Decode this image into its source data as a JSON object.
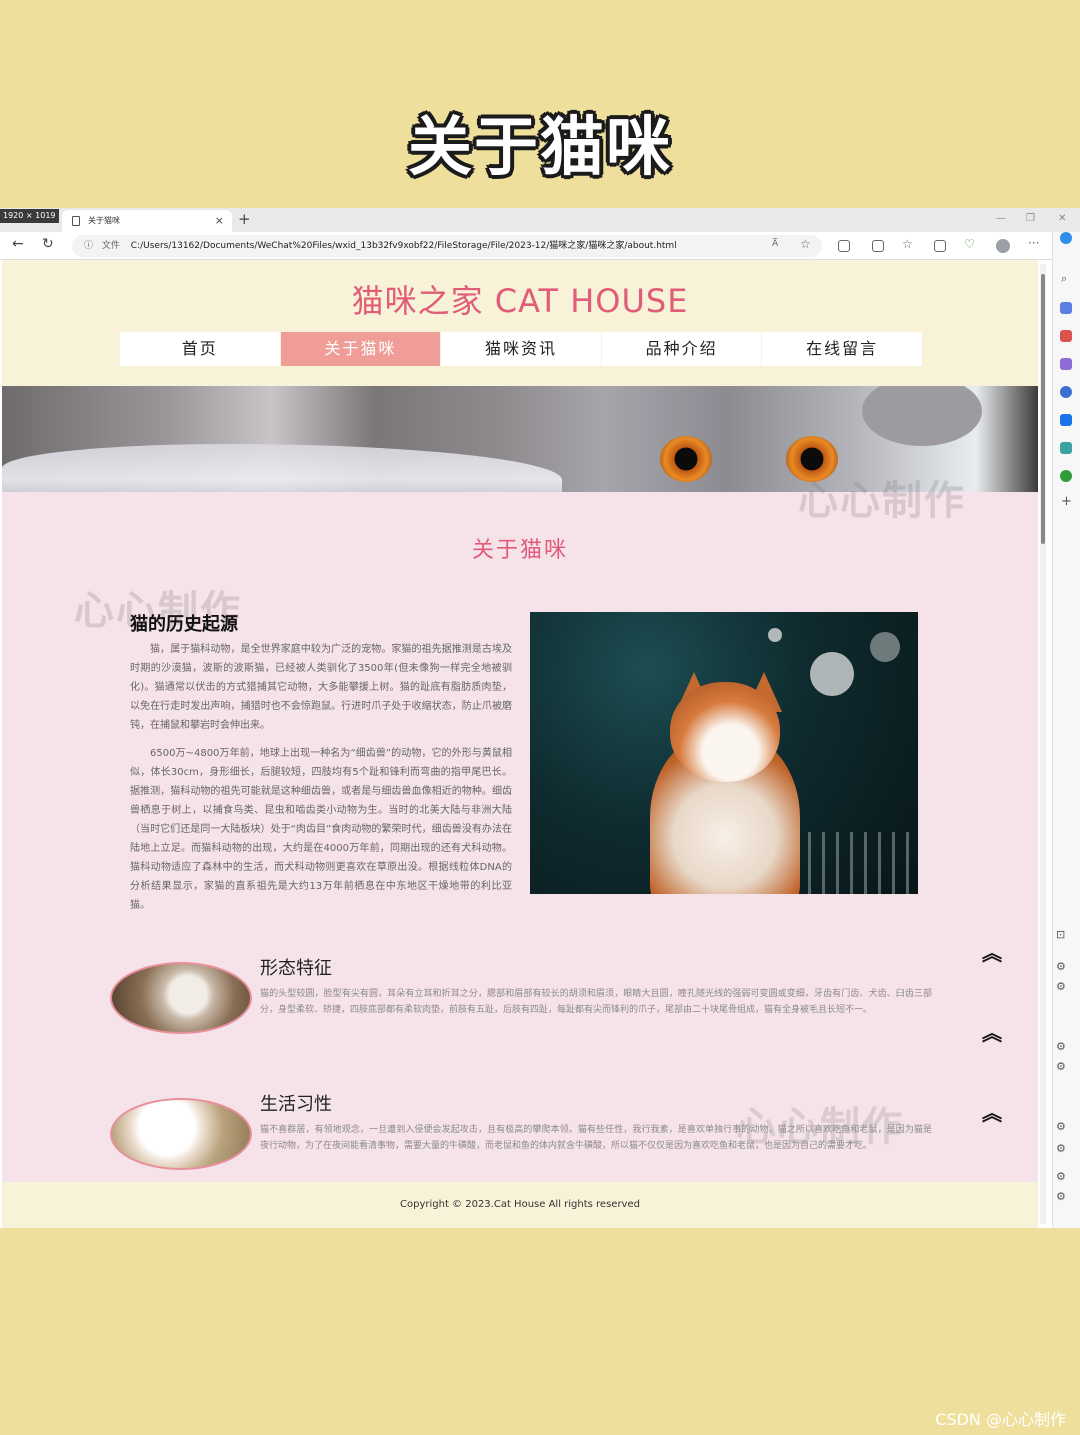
{
  "overlay_title": "关于猫咪",
  "browser": {
    "resolution_badge": "1920 × 1019",
    "tab_title": "关于猫咪",
    "tab_close": "×",
    "new_tab": "+",
    "address": {
      "info_icon": "ⓘ",
      "file_label": "文件",
      "url": "C:/Users/13162/Documents/WeChat%20Files/wxid_13b32fv9xobf22/FileStorage/File/2023-12/猫咪之家/猫咪之家/about.html"
    },
    "read_aloud": "A̅",
    "more": "···"
  },
  "site": {
    "title": "猫咪之家  CAT HOUSE",
    "nav": [
      {
        "label": "首页",
        "active": false
      },
      {
        "label": "关于猫咪",
        "active": true
      },
      {
        "label": "猫咪资讯",
        "active": false
      },
      {
        "label": "品种介绍",
        "active": false
      },
      {
        "label": "在线留言",
        "active": false
      }
    ],
    "watermark": "心心制作",
    "section_title": "关于猫咪",
    "history": {
      "heading": "猫的历史起源",
      "p1": "猫，属于猫科动物，是全世界家庭中较为广泛的宠物。家猫的祖先据推测是古埃及时期的沙漠猫，波斯的波斯猫，已经被人类驯化了3500年(但未像狗一样完全地被驯化)。猫通常以伏击的方式猎捕其它动物，大多能攀援上树。猫的趾底有脂肪质肉垫，以免在行走时发出声响，捕猎时也不会惊跑鼠。行进时爪子处于收缩状态，防止爪被磨钝，在捕鼠和攀岩时会伸出来。",
      "p2": "6500万~4800万年前，地球上出现一种名为“细齿兽”的动物，它的外形与黄鼠相似，体长30cm，身形细长，后腿较短，四肢均有5个趾和锋利而弯曲的指甲尾巴长。据推测，猫科动物的祖先可能就是这种细齿兽，或者是与细齿兽血像相近的物种。细齿兽栖息于树上，以捕食鸟类、昆虫和啮齿类小动物为生。当时的北美大陆与非洲大陆（当时它们还是同一大陆板块）处于“肉齿目”食肉动物的繁荣时代，细齿兽没有办法在陆地上立足。而猫科动物的出现，大约是在4000万年前，同期出现的还有犬科动物。猫科动物适应了森林中的生活，而犬科动物则更喜欢在草原出没。根据线粒体DNA的分析结果显示，家猫的直系祖先是大约13万年前栖息在中东地区干燥地带的利比亚猫。"
    },
    "features": [
      {
        "heading": "形态特征",
        "text": "猫的头型较圆，脸型有尖有圆，耳朵有立耳和折耳之分，腮部和眉部有较长的胡须和眉须，眼睛大且圆，瞳孔随光线的强弱可变圆或变细，牙齿有门齿、犬齿、臼齿三部分，身型柔软、矫捷，四肢底部都有柔软肉垫，前肢有五趾，后肢有四趾，每趾都有尖而锋利的爪子，尾部由二十块尾骨组成，猫有全身被毛且长短不一。"
      },
      {
        "heading": "生活习性",
        "text": "猫不喜群居，有领地观念，一旦遭到入侵便会发起攻击，且有极高的攀爬本领。猫有些任性，我行我素，是喜欢单独行事的动物。猫之所以喜欢吃鱼和老鼠，是因为猫是夜行动物，为了在夜间能看清事物，需要大量的牛磺酸，而老鼠和鱼的体内就含牛磺酸，所以猫不仅仅是因为喜欢吃鱼和老鼠，也是因为自己的需要才吃。"
      }
    ],
    "footer": "Copyright © 2023.Cat House All rights reserved"
  },
  "scroll_top_arrow": "︽",
  "corner_watermark": "CSDN @心心制作",
  "colors": {
    "background": "#efdf9c",
    "accent": "#e05c78",
    "nav_active": "#ef9d96",
    "header_bg": "#f8f2d9",
    "content_bg": "#f6e3ea"
  }
}
